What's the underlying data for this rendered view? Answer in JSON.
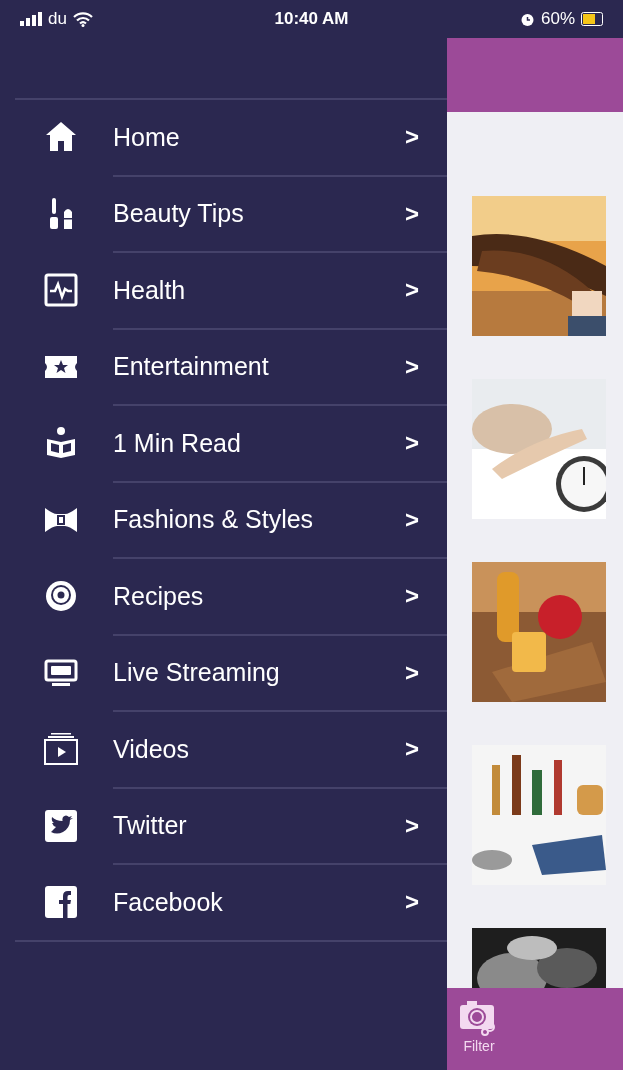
{
  "status_bar": {
    "carrier": "du",
    "time": "10:40 AM",
    "battery": "60%"
  },
  "menu": {
    "items": [
      {
        "label": "Home",
        "chevron": ">"
      },
      {
        "label": "Beauty Tips",
        "chevron": ">"
      },
      {
        "label": "Health",
        "chevron": ">"
      },
      {
        "label": "Entertainment",
        "chevron": ">"
      },
      {
        "label": "1 Min Read",
        "chevron": ">"
      },
      {
        "label": "Fashions & Styles",
        "chevron": ">"
      },
      {
        "label": "Recipes",
        "chevron": ">"
      },
      {
        "label": "Live Streaming",
        "chevron": ">"
      },
      {
        "label": "Videos",
        "chevron": ">"
      },
      {
        "label": "Twitter",
        "chevron": ">"
      },
      {
        "label": "Facebook",
        "chevron": ">"
      }
    ]
  },
  "bottom_bar": {
    "filter_label": "Filter"
  }
}
